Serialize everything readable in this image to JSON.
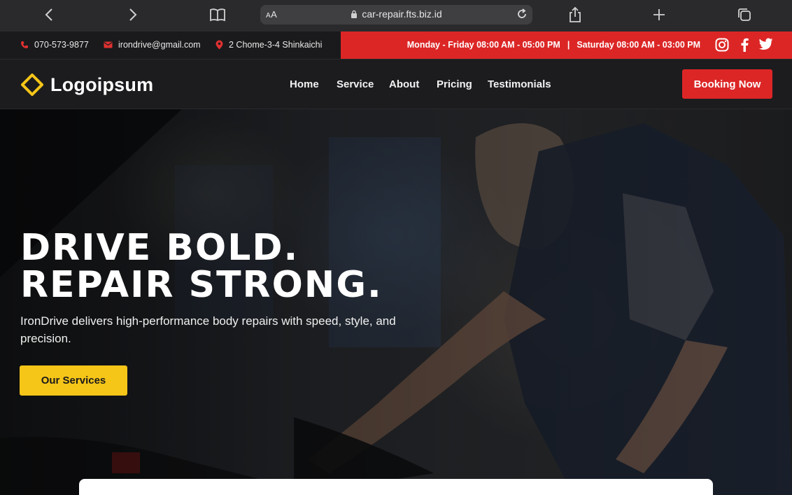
{
  "browser": {
    "aa_label_big": "A",
    "aa_label_small": "A",
    "url": "car-repair.fts.biz.id",
    "icons": [
      "back-icon",
      "forward-icon",
      "bookmarks-icon",
      "lock-icon",
      "reload-icon",
      "share-icon",
      "new-tab-icon",
      "tabs-icon"
    ]
  },
  "topbar": {
    "phone": "070-573-9877",
    "email": "irondrive@gmail.com",
    "address": "2 Chome-3-4 Shinkaichi",
    "hours_weekday": "Monday - Friday 08:00 AM - 05:00 PM",
    "hours_separator": "|",
    "hours_saturday": "Saturday 08:00 AM - 03:00 PM",
    "social_icons": [
      "instagram-icon",
      "facebook-icon",
      "twitter-icon"
    ]
  },
  "nav": {
    "logo_text": "Logoipsum",
    "links": [
      "Home",
      "Service",
      "About",
      "Pricing",
      "Testimonials"
    ],
    "cta": "Booking Now"
  },
  "hero": {
    "headline_line1": "DRIVE BOLD.",
    "headline_line2": "REPAIR STRONG.",
    "subtitle": "IronDrive delivers high-performance body repairs with speed, style, and precision.",
    "button": "Our Services"
  },
  "colors": {
    "accent_red": "#dc2626",
    "accent_yellow": "#f5c518",
    "dark_bg": "#1c1c1f"
  }
}
